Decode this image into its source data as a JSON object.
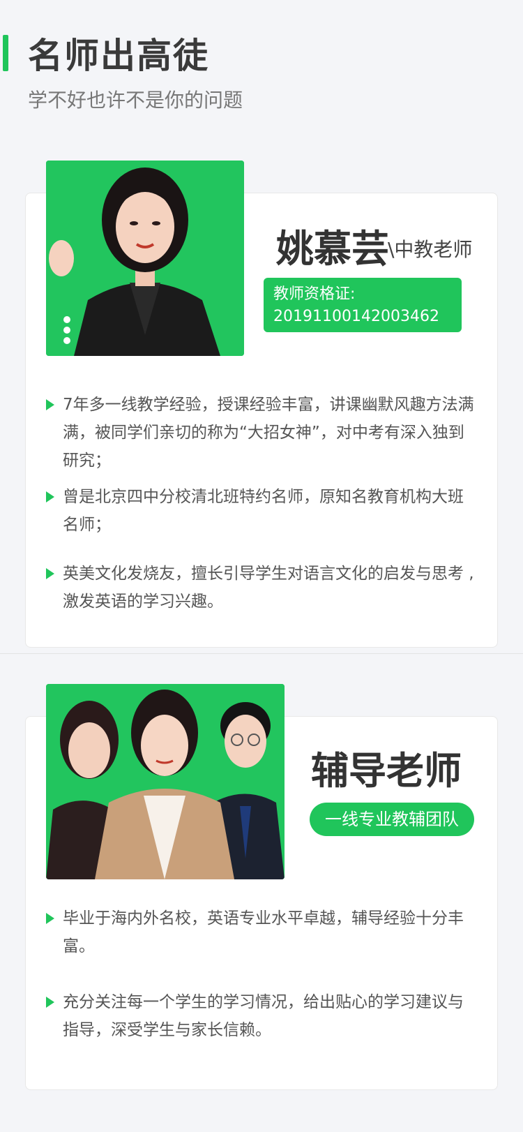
{
  "header": {
    "title": "名师出高徒",
    "subtitle": "学不好也许不是你的问题"
  },
  "teacher": {
    "name": "姚慕芸",
    "role": "\\中教老师",
    "cert_label": "教师资格证:",
    "cert_number": "20191100142003462",
    "bullets": [
      "7年多一线教学经验，授课经验丰富，讲课幽默风趣方法满满，被同学们亲切的称为“大招女神”，对中考有深入独到研究；",
      "曾是北京四中分校清北班特约名师，原知名教育机构大班名师；",
      "英美文化发烧友，擅长引导学生对语言文化的启发与思考 ,激发英语的学习兴趣。"
    ]
  },
  "tutors": {
    "name": "辅导老师",
    "badge": "一线专业教辅团队",
    "bullets": [
      "毕业于海内外名校，英语专业水平卓越，辅导经验十分丰富。",
      "充分关注每一个学生的学习情况，给出贴心的学习建议与指导，深受学生与家长信赖。"
    ]
  },
  "colors": {
    "accent": "#20c55b",
    "background": "#f4f5f8",
    "card": "#ffffff"
  }
}
